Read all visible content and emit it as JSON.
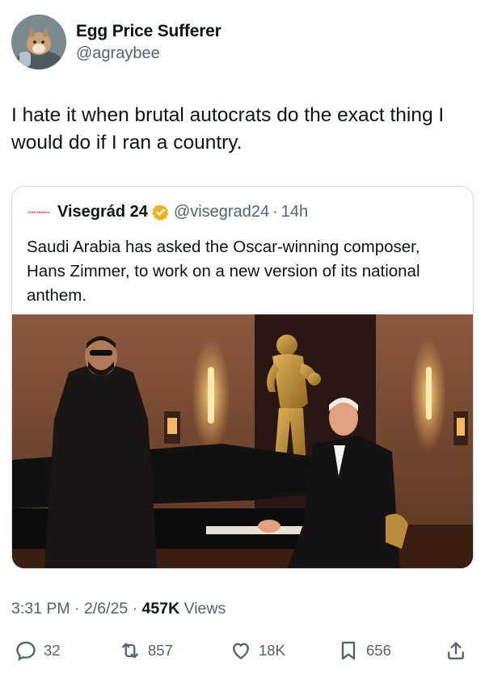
{
  "author": {
    "display_name": "Egg Price Sufferer",
    "handle": "@agraybee",
    "avatar_icon": "cat-avatar-icon"
  },
  "tweet": {
    "text": "I hate it when brutal autocrats do the exact thing I would do if I ran a country."
  },
  "quoted": {
    "logo_text": "VISEGRÁD24",
    "display_name": "Visegrád 24",
    "verified_icon": "gold-verified-badge-icon",
    "handle": "@visegrad24",
    "separator": "·",
    "time": "14h",
    "text": "Saudi Arabia has asked the Oscar-winning composer, Hans Zimmer, to work on a new version of its national anthem.",
    "image_description_icon": "photo-two-men-grand-piano"
  },
  "meta": {
    "time": "3:31 PM",
    "sep1": " · ",
    "date": "2/6/25",
    "sep2": " · ",
    "views_count": "457K",
    "views_label": " Views"
  },
  "actions": {
    "replies": "32",
    "reposts": "857",
    "likes": "18K",
    "bookmarks": "656"
  },
  "colors": {
    "text_primary": "#0f1419",
    "text_secondary": "#536471",
    "border": "#cfd9de",
    "verified_gold": "#e8b520"
  }
}
